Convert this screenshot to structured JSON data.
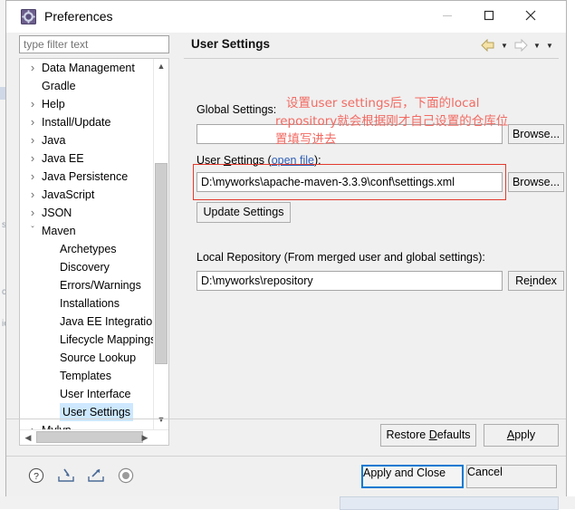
{
  "window": {
    "title": "Preferences",
    "icon": "preferences-gear-icon",
    "minimize_label": "Minimize",
    "maximize_label": "Maximize",
    "close_label": "Close"
  },
  "sidebar": {
    "filter_placeholder": "type filter text",
    "filter_value": "",
    "items": [
      {
        "label": "Data Management",
        "level": 0,
        "arrow": "collapsed",
        "selected": false
      },
      {
        "label": "Gradle",
        "level": 0,
        "arrow": "none",
        "selected": false
      },
      {
        "label": "Help",
        "level": 0,
        "arrow": "collapsed",
        "selected": false
      },
      {
        "label": "Install/Update",
        "level": 0,
        "arrow": "collapsed",
        "selected": false
      },
      {
        "label": "Java",
        "level": 0,
        "arrow": "collapsed",
        "selected": false
      },
      {
        "label": "Java EE",
        "level": 0,
        "arrow": "collapsed",
        "selected": false
      },
      {
        "label": "Java Persistence",
        "level": 0,
        "arrow": "collapsed",
        "selected": false
      },
      {
        "label": "JavaScript",
        "level": 0,
        "arrow": "collapsed",
        "selected": false
      },
      {
        "label": "JSON",
        "level": 0,
        "arrow": "collapsed",
        "selected": false
      },
      {
        "label": "Maven",
        "level": 0,
        "arrow": "expanded",
        "selected": false
      },
      {
        "label": "Archetypes",
        "level": 1,
        "arrow": "none",
        "selected": false
      },
      {
        "label": "Discovery",
        "level": 1,
        "arrow": "none",
        "selected": false
      },
      {
        "label": "Errors/Warnings",
        "level": 1,
        "arrow": "none",
        "selected": false
      },
      {
        "label": "Installations",
        "level": 1,
        "arrow": "none",
        "selected": false
      },
      {
        "label": "Java EE Integration",
        "level": 1,
        "arrow": "none",
        "selected": false
      },
      {
        "label": "Lifecycle Mappings",
        "level": 1,
        "arrow": "none",
        "selected": false
      },
      {
        "label": "Source Lookup",
        "level": 1,
        "arrow": "none",
        "selected": false
      },
      {
        "label": "Templates",
        "level": 1,
        "arrow": "none",
        "selected": false
      },
      {
        "label": "User Interface",
        "level": 1,
        "arrow": "none",
        "selected": false
      },
      {
        "label": "User Settings",
        "level": 1,
        "arrow": "none",
        "selected": true
      },
      {
        "label": "Mylyn",
        "level": 0,
        "arrow": "collapsed",
        "selected": false
      }
    ]
  },
  "page": {
    "title": "User Settings",
    "nav": {
      "back_icon": "back-arrow-icon",
      "back_menu_icon": "chevron-down-icon",
      "forward_icon": "forward-arrow-icon",
      "forward_menu_icon": "chevron-down-icon",
      "view_menu_icon": "chevron-down-icon"
    },
    "global_settings": {
      "label": "Global Settings:",
      "label_mnemonic": "S",
      "value": "",
      "browse_label": "Browse..."
    },
    "user_settings": {
      "label_prefix": "User ",
      "label_mnemonic": "S",
      "label_rest": "ettings (",
      "link_text": "open file",
      "label_suffix": "):",
      "value": "D:\\myworks\\apache-maven-3.3.9\\conf\\settings.xml",
      "browse_label": "Browse...",
      "update_label": "Update Settings"
    },
    "local_repository": {
      "label": "Local Repository (From merged user and global settings):",
      "value": "D:\\myworks\\repository",
      "reindex_label": "Reindex",
      "reindex_mnemonic": "i"
    },
    "annotation": {
      "line1": "设置user settings后，下面的local",
      "line2": "repository就会根据刚才自己设置的仓库位",
      "line3": "置填写进去",
      "color": "#f26a62"
    },
    "highlight_color": "#e23b2e",
    "restore_defaults_label": "Restore Defaults",
    "restore_defaults_mnemonic": "D",
    "apply_label": "Apply",
    "apply_mnemonic": "A"
  },
  "footer": {
    "help_icon": "help-question-icon",
    "import_icon": "import-icon",
    "export_icon": "export-icon",
    "record_icon": "record-circle-icon",
    "apply_and_close_label": "Apply and Close",
    "cancel_label": "Cancel",
    "focus_color": "#0a7ad1"
  }
}
